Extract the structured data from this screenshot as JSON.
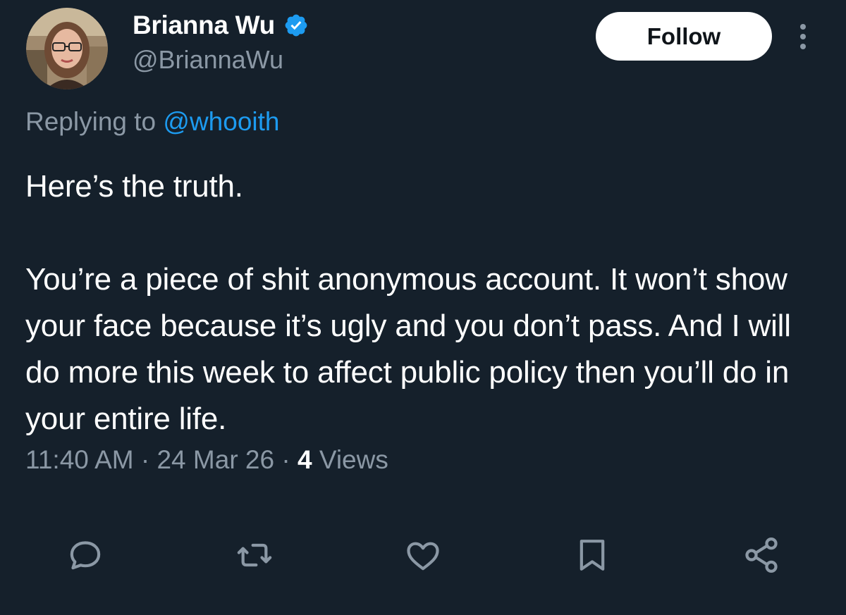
{
  "author": {
    "display_name": "Brianna Wu",
    "handle": "@BriannaWu",
    "verified_icon": "verified-badge-icon",
    "avatar_icon": "profile-photo"
  },
  "follow_button": {
    "label": "Follow"
  },
  "more_menu": {
    "icon": "more-vertical-icon"
  },
  "reply_context": {
    "prefix": "Replying to ",
    "mention": "@whooith"
  },
  "tweet": {
    "paragraph_1": "Here’s the truth.",
    "paragraph_2": "You’re a piece of shit anonymous account. It won’t show your face because it’s ugly and you don’t pass. And I will do more this week to affect public policy then you’ll do in your entire life."
  },
  "meta": {
    "time": "11:40 AM",
    "separator": " · ",
    "date": "24 Mar 26",
    "views_count": "4",
    "views_label": " Views"
  },
  "actions": [
    {
      "icon": "reply-icon"
    },
    {
      "icon": "retweet-icon"
    },
    {
      "icon": "like-icon"
    },
    {
      "icon": "bookmark-icon"
    },
    {
      "icon": "share-icon"
    }
  ],
  "colors": {
    "background": "#15202b",
    "primary_text": "#ffffff",
    "secondary_text": "#8b98a5",
    "accent": "#1d9bf0"
  }
}
